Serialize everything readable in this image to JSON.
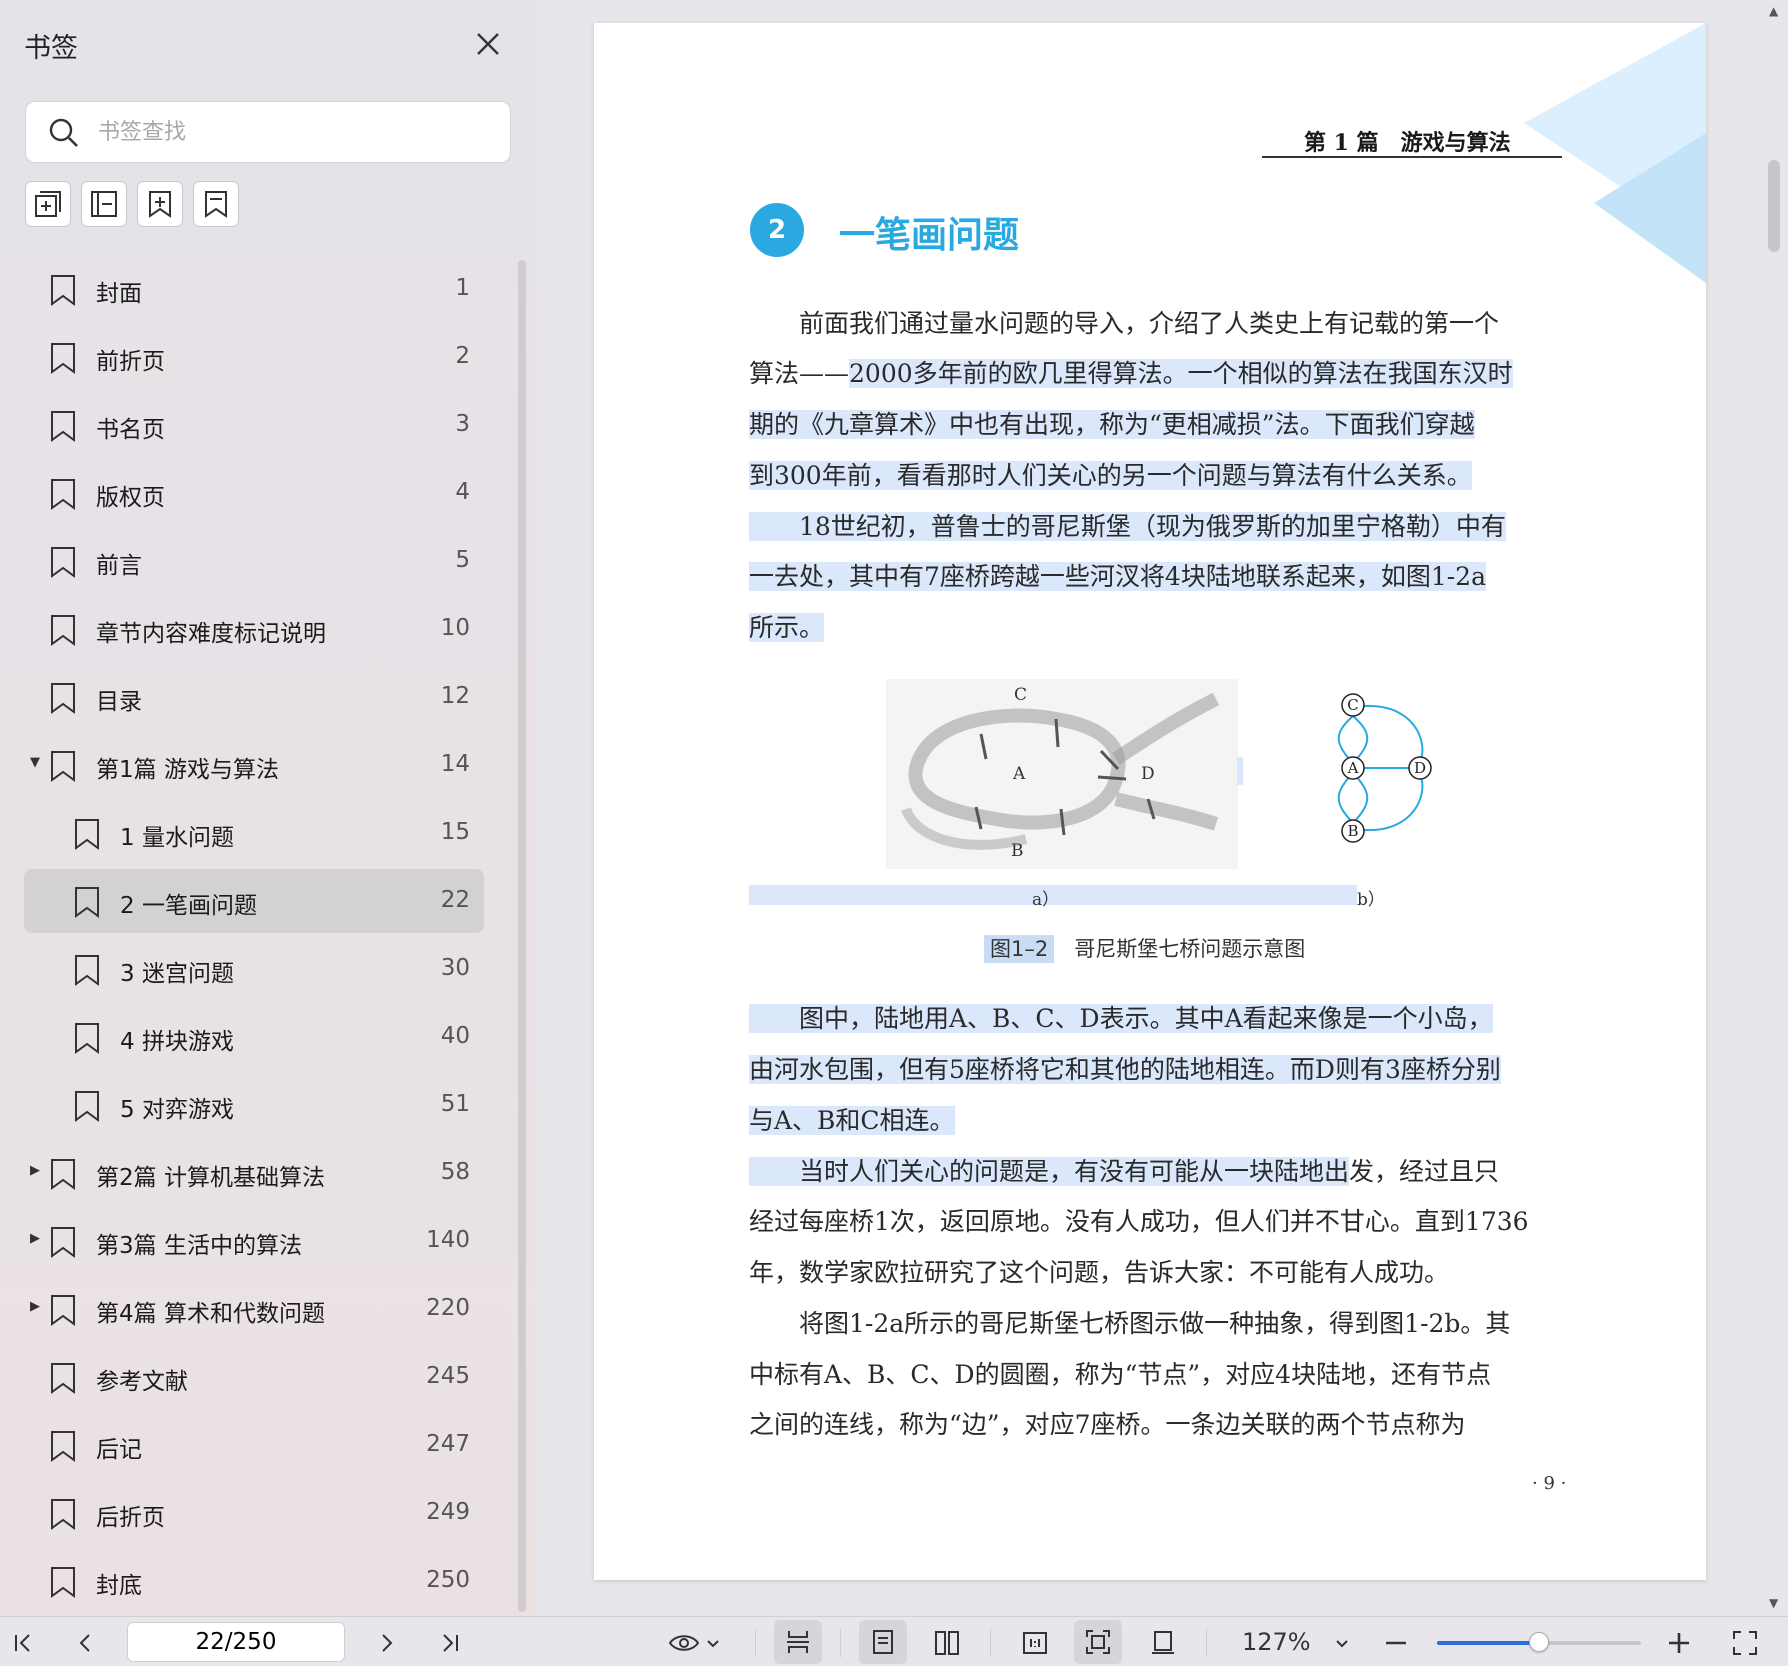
{
  "sidebar": {
    "title": "书签",
    "search_placeholder": "书签查找",
    "items": [
      {
        "label": "封面",
        "page": "1",
        "level": 0,
        "caret": ""
      },
      {
        "label": "前折页",
        "page": "2",
        "level": 0,
        "caret": ""
      },
      {
        "label": "书名页",
        "page": "3",
        "level": 0,
        "caret": ""
      },
      {
        "label": "版权页",
        "page": "4",
        "level": 0,
        "caret": ""
      },
      {
        "label": "前言",
        "page": "5",
        "level": 0,
        "caret": ""
      },
      {
        "label": "章节内容难度标记说明",
        "page": "10",
        "level": 0,
        "caret": ""
      },
      {
        "label": "目录",
        "page": "12",
        "level": 0,
        "caret": ""
      },
      {
        "label": "第1篇 游戏与算法",
        "page": "14",
        "level": 0,
        "caret": "▼"
      },
      {
        "label": "1 量水问题",
        "page": "15",
        "level": 1,
        "caret": ""
      },
      {
        "label": "2 一笔画问题",
        "page": "22",
        "level": 1,
        "caret": "",
        "selected": true
      },
      {
        "label": "3 迷宫问题",
        "page": "30",
        "level": 1,
        "caret": ""
      },
      {
        "label": "4 拼块游戏",
        "page": "40",
        "level": 1,
        "caret": ""
      },
      {
        "label": "5 对弈游戏",
        "page": "51",
        "level": 1,
        "caret": ""
      },
      {
        "label": "第2篇 计算机基础算法",
        "page": "58",
        "level": 0,
        "caret": "▶"
      },
      {
        "label": "第3篇 生活中的算法",
        "page": "140",
        "level": 0,
        "caret": "▶"
      },
      {
        "label": "第4篇 算术和代数问题",
        "page": "220",
        "level": 0,
        "caret": "▶"
      },
      {
        "label": "参考文献",
        "page": "245",
        "level": 0,
        "caret": ""
      },
      {
        "label": "后记",
        "page": "247",
        "level": 0,
        "caret": ""
      },
      {
        "label": "后折页",
        "page": "249",
        "level": 0,
        "caret": ""
      },
      {
        "label": "封底",
        "page": "250",
        "level": 0,
        "caret": ""
      }
    ]
  },
  "document": {
    "header_title": "第 1 篇　游戏与算法",
    "chapter_number": "2",
    "chapter_title": "一笔画问题",
    "lines": [
      {
        "text": "　　前面我们通过量水问题的导入，介绍了人类史上有记载的第一个",
        "hl": false
      },
      {
        "pre": "算法——",
        "text": "2000多年前的欧几里得算法。一个相似的算法在我国东汉时",
        "hl": true
      },
      {
        "text": "期的《九章算术》中也有出现，称为“更相减损”法。下面我们穿越",
        "hl": true
      },
      {
        "text": "到300年前，看看那时人们关心的另一个问题与算法有什么关系。",
        "hl": true
      },
      {
        "text": "　　18世纪初，普鲁士的哥尼斯堡（现为俄罗斯的加里宁格勒）中有",
        "hl": true
      },
      {
        "text": "一去处，其中有7座桥跨越一些河汊将4块陆地联系起来，如图1-2a",
        "hl": true
      },
      {
        "text": "所示。",
        "hl": true
      },
      {
        "text": "　　图中，陆地用A、B、C、D表示。其中A看起来像是一个小岛，",
        "hl": true
      },
      {
        "text": "由河水包围，但有5座桥将它和其他的陆地相连。而D则有3座桥分别",
        "hl": true
      },
      {
        "text": "与A、B和C相连。",
        "hl": true
      },
      {
        "text": "　　当时人们关心的问题是，有没有可能从一块陆地出",
        "post": "发，经过且只",
        "hl": true
      },
      {
        "text": "经过每座桥1次，返回原地。没有人成功，但人们并不甘心。直到1736",
        "hl": false
      },
      {
        "text": "年，数学家欧拉研究了这个问题，告诉大家：不可能有人成功。",
        "hl": false
      },
      {
        "text": "　　将图1-2a所示的哥尼斯堡七桥图示做一种抽象，得到图1-2b。其",
        "hl": false
      },
      {
        "text": "中标有A、B、C、D的圆圈，称为“节点”，对应4块陆地，还有节点",
        "hl": false
      },
      {
        "text": "之间的连线，称为“边”，对应7座桥。一条边关联的两个节点称为",
        "hl": false
      }
    ],
    "figure": {
      "photo_labels": {
        "c": "C",
        "a": "A",
        "d": "D",
        "b": "B"
      },
      "graph_nodes": {
        "c": "C",
        "a": "A",
        "d": "D",
        "b": "B"
      },
      "sub_a": "a）",
      "sub_b": "b）",
      "caption_num": "图1–2",
      "caption_text": "哥尼斯堡七桥问题示意图"
    },
    "page_number": "· 9 ·"
  },
  "toolbar": {
    "page_value": "22/250",
    "zoom": "127%",
    "zoom_fraction": 0.5,
    "accent": "#2d6fd8"
  }
}
